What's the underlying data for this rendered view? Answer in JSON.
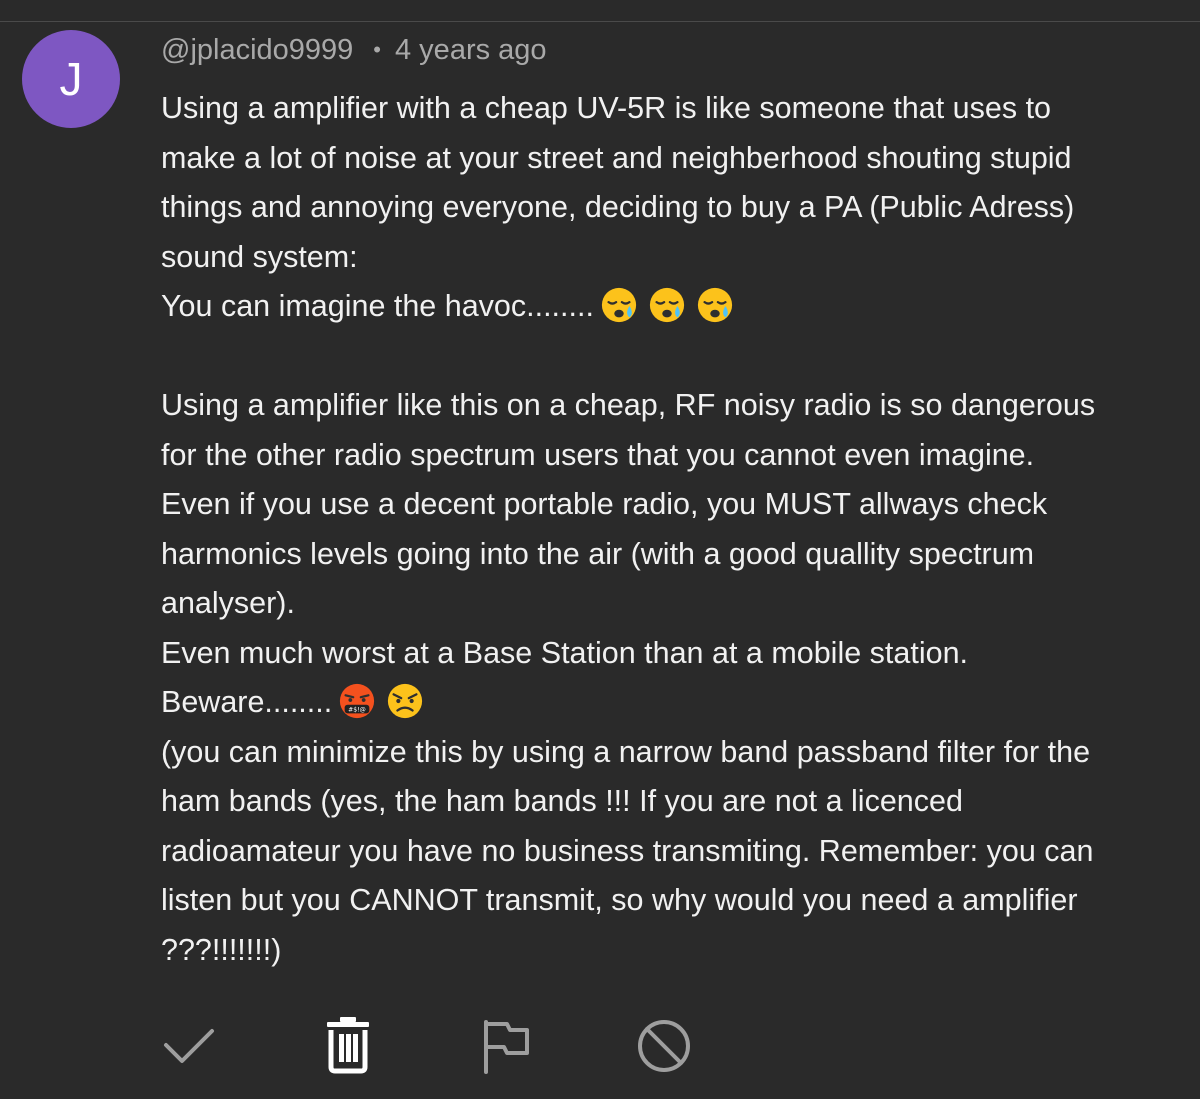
{
  "comment": {
    "avatar_letter": "J",
    "avatar_color": "#7e57c2",
    "author": "@jplacido9999",
    "separator": "•",
    "timestamp": "4 years ago",
    "lines": [
      "Using a amplifier with a cheap UV-5R is like someone that uses to",
      "make a lot of noise at your street and neighberhood shouting stupid",
      "things and annoying everyone, deciding to buy a PA (Public Adress)",
      "sound system:",
      "You can imagine the havoc........",
      "",
      "Using a amplifier like this on a cheap, RF noisy radio is so dangerous",
      "for the other radio spectrum users that you cannot even imagine.",
      "Even if you use a decent portable radio, you MUST allways check",
      "harmonics levels going into the air (with a good quallity spectrum",
      "analyser).",
      "Even much worst at a Base Station than at a mobile station.",
      "Beware........",
      "(you can minimize this by using a narrow band passband filter for the",
      "ham bands (yes, the ham bands !!! If you are not a licenced",
      "radioamateur you have no business transmiting. Remember: you can",
      "listen but you CANNOT transmit, so why would you need a amplifier",
      "???!!!!!!!)"
    ],
    "emoji_line_1": [
      "sleepy-face-emoji",
      "sleepy-face-emoji",
      "sleepy-face-emoji"
    ],
    "emoji_line_2": [
      "face-with-symbols-on-mouth-emoji",
      "angry-face-emoji"
    ]
  },
  "actions": [
    {
      "icon": "check-icon"
    },
    {
      "icon": "trash-icon"
    },
    {
      "icon": "flag-icon"
    },
    {
      "icon": "block-icon"
    }
  ],
  "colors": {
    "background": "#2a2a2a",
    "text": "#f1f1f1",
    "meta_text": "#a9a9a9",
    "icon": "#9e9e9e",
    "trash_icon": "#ffffff"
  }
}
